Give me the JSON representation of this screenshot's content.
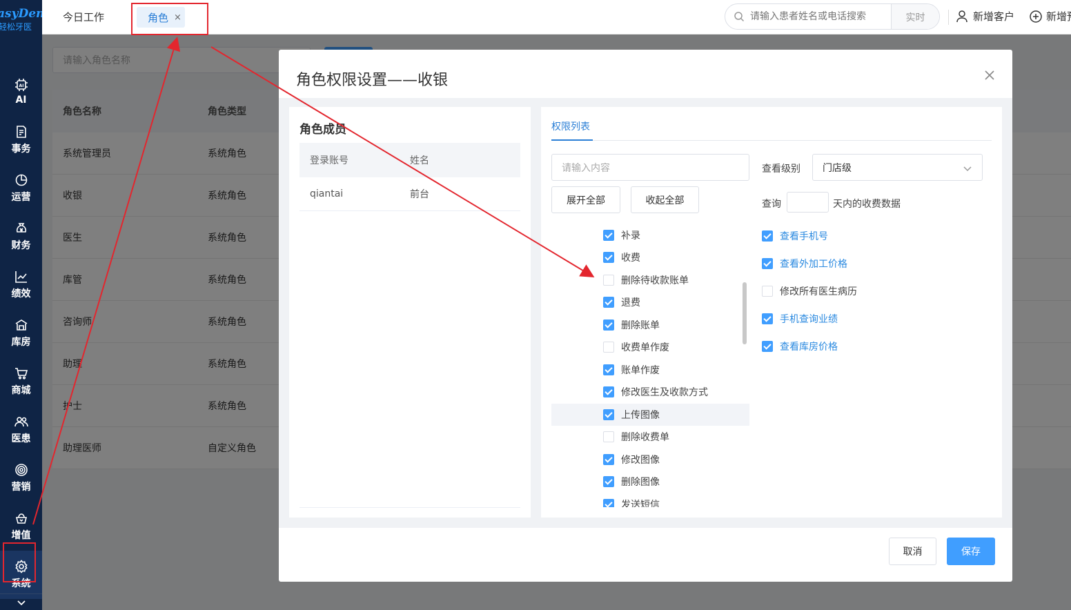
{
  "brand": {
    "name_en": "asyDent",
    "name_cn": "轻松牙医"
  },
  "sidebar": {
    "items": [
      {
        "label": "AI",
        "icon": "ai-chip-icon"
      },
      {
        "label": "事务",
        "icon": "document-icon"
      },
      {
        "label": "运营",
        "icon": "pie-chart-icon"
      },
      {
        "label": "财务",
        "icon": "money-bag-icon"
      },
      {
        "label": "绩效",
        "icon": "line-chart-icon"
      },
      {
        "label": "库房",
        "icon": "warehouse-icon"
      },
      {
        "label": "商城",
        "icon": "cart-icon"
      },
      {
        "label": "医患",
        "icon": "people-icon"
      },
      {
        "label": "营销",
        "icon": "target-icon"
      },
      {
        "label": "增值",
        "icon": "crown-basket-icon"
      },
      {
        "label": "系统",
        "icon": "gear-icon"
      }
    ],
    "active": "系统"
  },
  "topbar": {
    "tab_today": "今日工作",
    "tab_role": "角色",
    "tab_close": "×",
    "search_placeholder": "请输入患者姓名或电话搜索",
    "search_mode": "实时",
    "new_customer": "新增客户",
    "new_appointment": "新增预约"
  },
  "background_page": {
    "search_placeholder": "请输入角色名称",
    "columns": [
      "角色名称",
      "角色类型"
    ],
    "rows": [
      [
        "系统管理员",
        "系统角色"
      ],
      [
        "收银",
        "系统角色"
      ],
      [
        "医生",
        "系统角色"
      ],
      [
        "库管",
        "系统角色"
      ],
      [
        "咨询师",
        "系统角色"
      ],
      [
        "助理",
        "系统角色"
      ],
      [
        "护士",
        "系统角色"
      ],
      [
        "助理医师",
        "自定义角色"
      ]
    ]
  },
  "modal": {
    "title": "角色权限设置——收银",
    "members": {
      "heading": "角色成员",
      "columns": [
        "登录账号",
        "姓名"
      ],
      "rows": [
        [
          "qiantai",
          "前台"
        ]
      ]
    },
    "permissions": {
      "tab": "权限列表",
      "search_placeholder": "请输入内容",
      "expand_all": "展开全部",
      "collapse_all": "收起全部",
      "tree": [
        {
          "label": "补录",
          "checked": true
        },
        {
          "label": "收费",
          "checked": true
        },
        {
          "label": "删除待收款账单",
          "checked": false
        },
        {
          "label": "退费",
          "checked": true
        },
        {
          "label": "删除账单",
          "checked": true
        },
        {
          "label": "收费单作废",
          "checked": false
        },
        {
          "label": "账单作废",
          "checked": true
        },
        {
          "label": "修改医生及收款方式",
          "checked": true
        },
        {
          "label": "上传图像",
          "checked": true,
          "highlight": true
        },
        {
          "label": "删除收费单",
          "checked": false
        },
        {
          "label": "修改图像",
          "checked": true
        },
        {
          "label": "删除图像",
          "checked": true
        },
        {
          "label": "发送短信",
          "checked": true
        }
      ],
      "view_level_label": "查看级别",
      "view_level_value": "门店级",
      "query_prefix": "查询",
      "query_suffix": "天内的收费数据",
      "options": [
        {
          "label": "查看手机号",
          "checked": true
        },
        {
          "label": "查看外加工价格",
          "checked": true
        },
        {
          "label": "修改所有医生病历",
          "checked": false
        },
        {
          "label": "手机查询业绩",
          "checked": true
        },
        {
          "label": "查看库房价格",
          "checked": true
        }
      ]
    },
    "cancel": "取消",
    "save": "保存"
  },
  "colors": {
    "sidebar_bg": "#0f2445",
    "accent": "#409eff",
    "annotation": "#e3262e"
  }
}
